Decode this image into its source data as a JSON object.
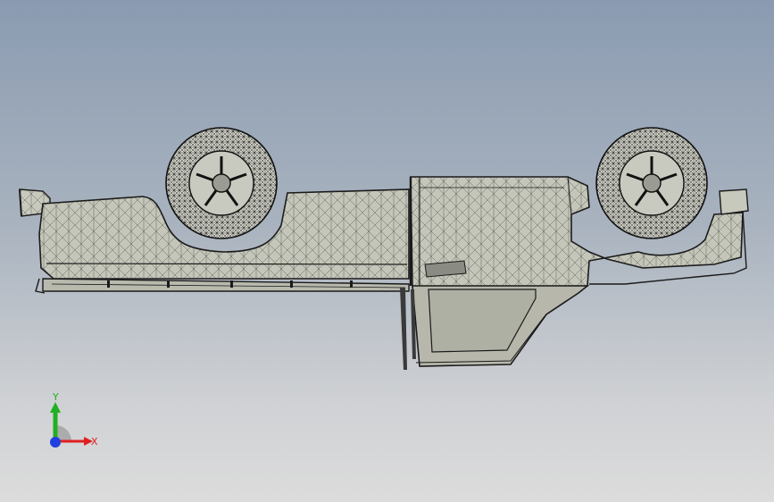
{
  "viewport": {
    "background_top": "#8a9bb1",
    "background_bottom": "#dcdcdc",
    "model_fill": "#c4c6b9",
    "edge_color": "#1a1a1a"
  },
  "triad": {
    "x_label": "X",
    "y_label": "Y",
    "x_color": "#e02020",
    "y_color": "#20b020",
    "z_color": "#2040e0"
  }
}
